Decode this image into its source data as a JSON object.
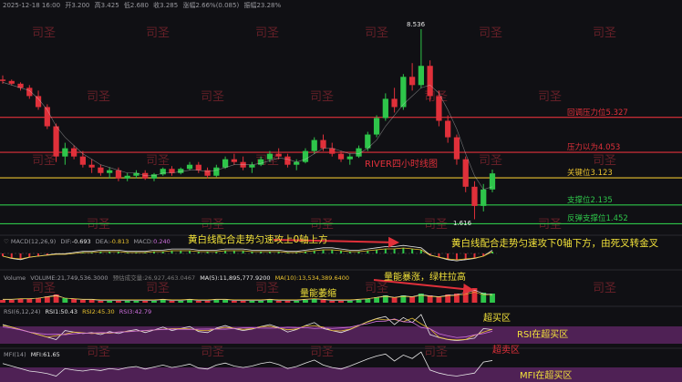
{
  "header": {
    "datetime": "2025-12-18 16:00",
    "open_label": "开",
    "open": "3.200",
    "high_label": "高",
    "high": "3.425",
    "low_label": "低",
    "low": "2.680",
    "close_label": "收",
    "close": "3.285",
    "change_label": "涨幅",
    "change": "2.66%(0.085)",
    "amp_label": "振幅",
    "amp": "23.28%"
  },
  "watermark": "司圣",
  "chart_data": {
    "type": "candlestick",
    "title": "RIVER四小时线图",
    "price_high_label": "8.536",
    "price_low_label": "1.616",
    "ylim": [
      1.3,
      9.0
    ],
    "ohlc": [
      [
        6.7,
        6.85,
        6.55,
        6.65
      ],
      [
        6.65,
        6.7,
        6.5,
        6.55
      ],
      [
        6.55,
        6.6,
        6.3,
        6.4
      ],
      [
        6.4,
        6.5,
        6.0,
        6.1
      ],
      [
        6.1,
        6.3,
        5.6,
        5.7
      ],
      [
        5.7,
        5.8,
        4.9,
        5.0
      ],
      [
        5.0,
        5.1,
        3.7,
        3.9
      ],
      [
        3.9,
        4.4,
        3.6,
        4.2
      ],
      [
        4.2,
        4.3,
        3.8,
        3.9
      ],
      [
        3.9,
        4.1,
        3.5,
        3.6
      ],
      [
        3.6,
        3.8,
        3.3,
        3.5
      ],
      [
        3.5,
        3.6,
        3.2,
        3.3
      ],
      [
        3.3,
        3.5,
        3.1,
        3.4
      ],
      [
        3.4,
        3.5,
        3.0,
        3.1
      ],
      [
        3.1,
        3.3,
        3.0,
        3.2
      ],
      [
        3.2,
        3.4,
        3.1,
        3.3
      ],
      [
        3.3,
        3.4,
        3.05,
        3.1
      ],
      [
        3.1,
        3.3,
        3.0,
        3.25
      ],
      [
        3.25,
        3.5,
        3.2,
        3.45
      ],
      [
        3.45,
        3.55,
        3.2,
        3.3
      ],
      [
        3.3,
        3.5,
        3.25,
        3.45
      ],
      [
        3.45,
        3.7,
        3.4,
        3.6
      ],
      [
        3.6,
        3.7,
        3.3,
        3.4
      ],
      [
        3.4,
        3.5,
        3.1,
        3.2
      ],
      [
        3.2,
        3.6,
        3.15,
        3.5
      ],
      [
        3.5,
        3.9,
        3.45,
        3.8
      ],
      [
        3.8,
        4.0,
        3.6,
        3.7
      ],
      [
        3.7,
        3.9,
        3.4,
        3.5
      ],
      [
        3.5,
        3.7,
        3.3,
        3.6
      ],
      [
        3.6,
        3.9,
        3.55,
        3.8
      ],
      [
        3.8,
        4.1,
        3.7,
        4.0
      ],
      [
        4.0,
        4.2,
        3.8,
        3.9
      ],
      [
        3.9,
        4.0,
        3.5,
        3.6
      ],
      [
        3.6,
        3.8,
        3.4,
        3.7
      ],
      [
        3.7,
        4.2,
        3.65,
        4.1
      ],
      [
        4.1,
        4.6,
        4.0,
        4.5
      ],
      [
        4.5,
        4.7,
        4.1,
        4.2
      ],
      [
        4.2,
        4.4,
        3.9,
        4.0
      ],
      [
        4.0,
        4.1,
        3.7,
        3.8
      ],
      [
        3.8,
        4.0,
        3.6,
        3.9
      ],
      [
        3.9,
        4.3,
        3.85,
        4.2
      ],
      [
        4.2,
        4.8,
        4.1,
        4.7
      ],
      [
        4.7,
        5.4,
        4.6,
        5.3
      ],
      [
        5.3,
        6.2,
        5.2,
        6.0
      ],
      [
        6.0,
        6.4,
        5.5,
        5.7
      ],
      [
        5.7,
        6.9,
        5.6,
        6.8
      ],
      [
        6.8,
        7.3,
        6.3,
        6.5
      ],
      [
        6.5,
        8.536,
        6.4,
        7.2
      ],
      [
        7.2,
        7.4,
        5.9,
        6.1
      ],
      [
        6.1,
        6.3,
        5.0,
        5.2
      ],
      [
        5.2,
        5.4,
        4.4,
        4.6
      ],
      [
        4.6,
        4.7,
        3.6,
        3.8
      ],
      [
        3.8,
        3.9,
        2.6,
        2.8
      ],
      [
        2.8,
        3.0,
        1.616,
        2.1
      ],
      [
        2.1,
        2.9,
        1.9,
        2.7
      ],
      [
        2.7,
        3.425,
        2.6,
        3.285
      ]
    ],
    "levels": [
      {
        "label": "回调压力位5.327",
        "value": 5.327,
        "color": "#e0303a"
      },
      {
        "label": "压力以为4.053",
        "value": 4.053,
        "color": "#e0303a"
      },
      {
        "label": "关键位3.123",
        "value": 3.123,
        "color": "#e8c12e"
      },
      {
        "label": "支撑位2.135",
        "value": 2.135,
        "color": "#2ec54a"
      },
      {
        "label": "反弹支撑位1.452",
        "value": 1.452,
        "color": "#2ec54a"
      }
    ],
    "ma_line": [
      6.6,
      6.5,
      6.4,
      6.3,
      6.0,
      5.6,
      5.0,
      4.6,
      4.3,
      4.0,
      3.8,
      3.6,
      3.5,
      3.4,
      3.3,
      3.3,
      3.2,
      3.2,
      3.3,
      3.3,
      3.35,
      3.4,
      3.4,
      3.35,
      3.4,
      3.5,
      3.6,
      3.6,
      3.6,
      3.65,
      3.75,
      3.85,
      3.8,
      3.7,
      3.8,
      4.0,
      4.2,
      4.2,
      4.1,
      4.0,
      4.0,
      4.2,
      4.5,
      5.0,
      5.4,
      5.8,
      6.1,
      6.4,
      6.5,
      6.2,
      5.6,
      4.9,
      4.0,
      3.2,
      2.7,
      2.8
    ]
  },
  "macd": {
    "title": "MACD(12,26,9)",
    "dif_label": "DIF:",
    "dif": "-0.693",
    "dea_label": "DEA:",
    "dea": "-0.813",
    "macd_label": "MACD:",
    "macd": "0.240",
    "annotation_1": "黄白线配合走势匀速攻上0轴上方",
    "annotation_2": "黄白线配合走势匀速攻下0轴下方，由死叉转金叉"
  },
  "volume": {
    "title": "Volume",
    "vol_label": "VOLUME:",
    "vol": "21,749,536.3000",
    "pred_label": "预估成交量:",
    "pred": "26,927,463.0467",
    "ma5_label": "MA(5):",
    "ma5": "11,895,777.9200",
    "ma10_label": "MA(10):",
    "ma10": "13,534,389.6400",
    "annotation_1": "量能萎缩",
    "annotation_2": "量能暴涨，绿柱拉高"
  },
  "rsi": {
    "title": "RSI(6,12,24)",
    "r1_label": "RSI1:",
    "r1": "50.43",
    "r2_label": "RSI2:",
    "r2": "45.30",
    "r3_label": "RSI3:",
    "r3": "42.79",
    "overbought": "超买区",
    "in_oversold": "RSI在超买区",
    "oversold": "超卖区"
  },
  "mfi": {
    "title": "MFI(14)",
    "mfi_label": "MFI:",
    "mfi": "61.65",
    "in_zone": "MFI在超买区"
  },
  "colors": {
    "bg": "#101014",
    "up": "#2ec54a",
    "down": "#e0303a",
    "yellow": "#e8c12e",
    "purple": "#5a2460",
    "annot": "#f2e23a",
    "watermark": "#c8333f"
  }
}
